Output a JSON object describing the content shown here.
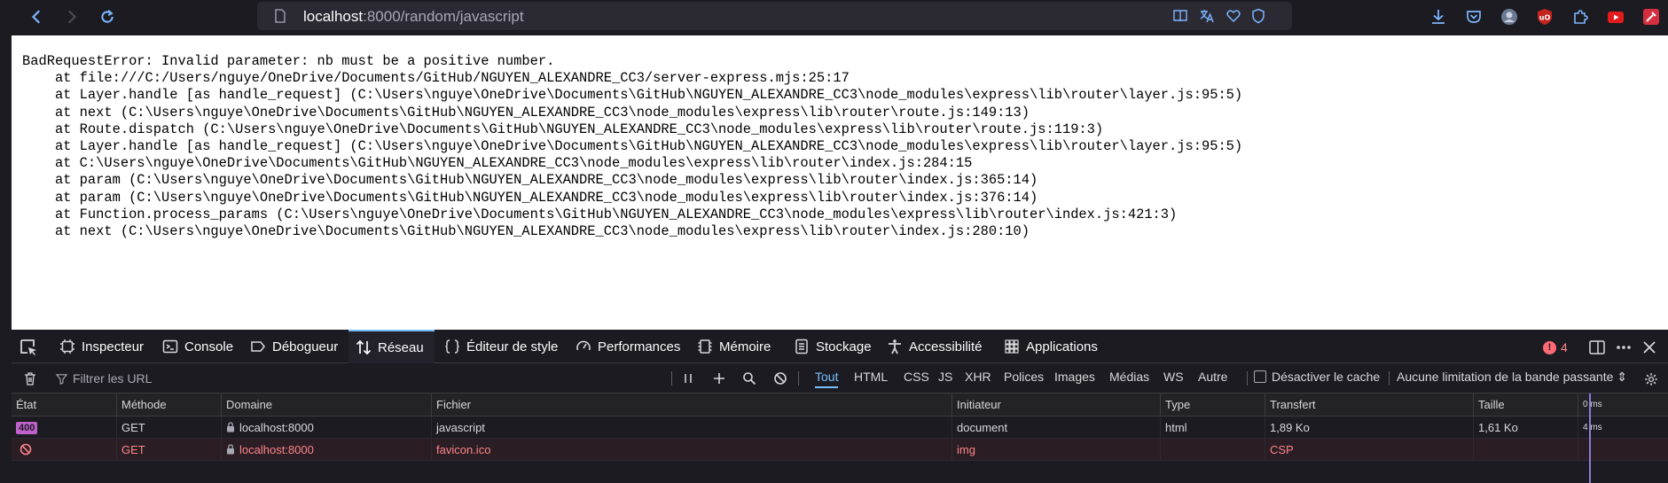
{
  "browser": {
    "url_host": "localhost",
    "url_rest": ":8000/random/javascript",
    "icons": {
      "back": "back-arrow-icon",
      "forward": "forward-arrow-icon",
      "reload": "reload-icon",
      "reader": "reader-view-icon",
      "translate": "translate-icon",
      "bookmark": "bookmark-heart-icon",
      "shield": "tracking-protection-icon"
    }
  },
  "page": {
    "error_lines": [
      "BadRequestError: Invalid parameter: nb must be a positive number.",
      "    at file:///C:/Users/nguye/OneDrive/Documents/GitHub/NGUYEN_ALEXANDRE_CC3/server-express.mjs:25:17",
      "    at Layer.handle [as handle_request] (C:\\Users\\nguye\\OneDrive\\Documents\\GitHub\\NGUYEN_ALEXANDRE_CC3\\node_modules\\express\\lib\\router\\layer.js:95:5)",
      "    at next (C:\\Users\\nguye\\OneDrive\\Documents\\GitHub\\NGUYEN_ALEXANDRE_CC3\\node_modules\\express\\lib\\router\\route.js:149:13)",
      "    at Route.dispatch (C:\\Users\\nguye\\OneDrive\\Documents\\GitHub\\NGUYEN_ALEXANDRE_CC3\\node_modules\\express\\lib\\router\\route.js:119:3)",
      "    at Layer.handle [as handle_request] (C:\\Users\\nguye\\OneDrive\\Documents\\GitHub\\NGUYEN_ALEXANDRE_CC3\\node_modules\\express\\lib\\router\\layer.js:95:5)",
      "    at C:\\Users\\nguye\\OneDrive\\Documents\\GitHub\\NGUYEN_ALEXANDRE_CC3\\node_modules\\express\\lib\\router\\index.js:284:15",
      "    at param (C:\\Users\\nguye\\OneDrive\\Documents\\GitHub\\NGUYEN_ALEXANDRE_CC3\\node_modules\\express\\lib\\router\\index.js:365:14)",
      "    at param (C:\\Users\\nguye\\OneDrive\\Documents\\GitHub\\NGUYEN_ALEXANDRE_CC3\\node_modules\\express\\lib\\router\\index.js:376:14)",
      "    at Function.process_params (C:\\Users\\nguye\\OneDrive\\Documents\\GitHub\\NGUYEN_ALEXANDRE_CC3\\node_modules\\express\\lib\\router\\index.js:421:3)",
      "    at next (C:\\Users\\nguye\\OneDrive\\Documents\\GitHub\\NGUYEN_ALEXANDRE_CC3\\node_modules\\express\\lib\\router\\index.js:280:10)"
    ]
  },
  "devtools": {
    "tabs": {
      "inspector": "Inspecteur",
      "console": "Console",
      "debugger": "Débogueur",
      "network": "Réseau",
      "style_editor": "Éditeur de style",
      "performance": "Performances",
      "memory": "Mémoire",
      "storage": "Stockage",
      "accessibility": "Accessibilité",
      "applications": "Applications"
    },
    "active_tab": "network",
    "error_count": "4",
    "filter": {
      "placeholder": "Filtrer les URL",
      "types": {
        "all": "Tout",
        "html": "HTML",
        "css": "CSS",
        "js": "JS",
        "xhr": "XHR",
        "fonts": "Polices",
        "images": "Images",
        "media": "Médias",
        "ws": "WS",
        "other": "Autre"
      },
      "disable_cache": "Désactiver le cache",
      "throttling": "Aucune limitation de la bande passante ⇕"
    },
    "columns": {
      "status": "État",
      "method": "Méthode",
      "domain": "Domaine",
      "file": "Fichier",
      "initiator": "Initiateur",
      "type": "Type",
      "transferred": "Transfert",
      "size": "Taille",
      "timeline": "0 ms"
    },
    "requests": [
      {
        "status": "400",
        "method": "GET",
        "domain": "localhost:8000",
        "file": "javascript",
        "initiator": "document",
        "type": "html",
        "transferred": "1,89 Ko",
        "size": "1,61 Ko",
        "time": "4 ms"
      },
      {
        "status": "",
        "method": "GET",
        "domain": "localhost:8000",
        "file": "favicon.ico",
        "initiator": "img",
        "type": "",
        "transferred": "CSP",
        "size": "",
        "time": ""
      }
    ]
  },
  "colors": {
    "accent": "#75bfff",
    "error": "#ff6a75",
    "status_400": "#c061cb",
    "blocked_text": "#ff848b"
  }
}
